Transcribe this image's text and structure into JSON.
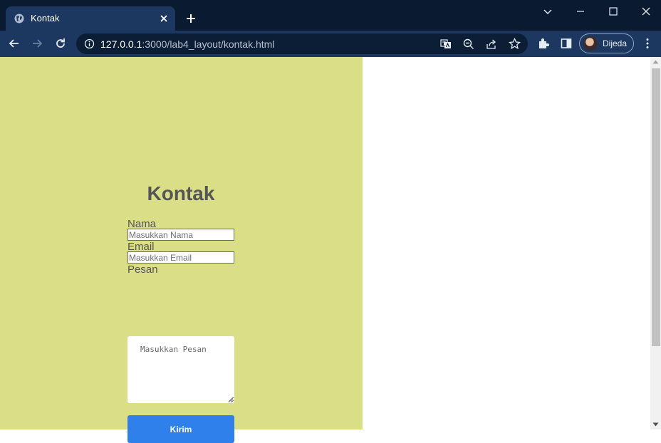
{
  "browser": {
    "tab_title": "Kontak",
    "url_host": "127.0.0.1",
    "url_path": ":3000/lab4_layout/kontak.html",
    "profile_name": "Dijeda",
    "icons": [
      "globe-icon",
      "close-icon",
      "plus-icon",
      "chevron-down-icon",
      "minimize-icon",
      "maximize-icon",
      "window-close-icon",
      "back-icon",
      "forward-icon",
      "reload-icon",
      "info-icon",
      "translate-icon",
      "zoom-out-icon",
      "share-icon",
      "star-icon",
      "extensions-icon",
      "side-panel-icon",
      "kebab-menu-icon"
    ]
  },
  "page": {
    "heading": "Kontak",
    "name_label": "Nama",
    "name_placeholder": "Masukkan Nama",
    "email_label": "Email",
    "email_placeholder": "Masukkan Email",
    "message_label": "Pesan",
    "message_placeholder": "Masukkan Pesan",
    "submit_label": "Kirim"
  },
  "colors": {
    "panel_background": "#dadf87",
    "button_background": "#2f80ea",
    "chrome_dark": "#0a1a31",
    "chrome_toolbar": "#1c3760"
  }
}
